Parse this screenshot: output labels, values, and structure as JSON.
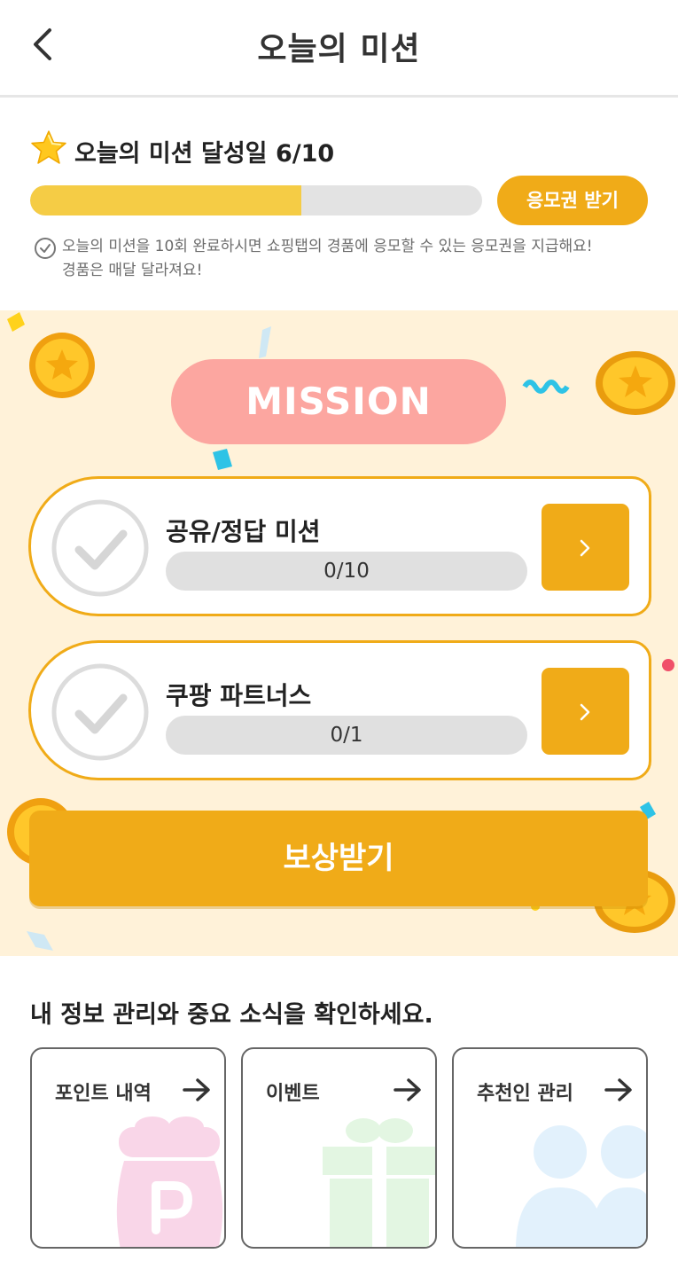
{
  "header": {
    "title": "오늘의 미션"
  },
  "progress": {
    "title": "오늘의 미션 달성일",
    "count": "6/10",
    "fraction": 0.6,
    "voucher_button": "응모권 받기",
    "notice_line1": "오늘의 미션을 10회 완료하시면 쇼핑탭의 경품에 응모할 수 있는 응모권을 지급해요!",
    "notice_line2": "경품은 매달 달라져요!"
  },
  "mission": {
    "badge": "MISSION",
    "cards": [
      {
        "title": "공유/정답 미션",
        "progress_text": "0/10"
      },
      {
        "title": "쿠팡 파트너스",
        "progress_text": "0/1"
      }
    ],
    "reward_button": "보상받기"
  },
  "info": {
    "title": "내 정보 관리와 중요 소식을 확인하세요.",
    "cards": [
      {
        "label": "포인트 내역",
        "icon": "point-pouch-icon"
      },
      {
        "label": "이벤트",
        "icon": "gift-icon"
      },
      {
        "label": "추천인 관리",
        "icon": "people-icon"
      }
    ]
  },
  "colors": {
    "accent": "#f0ab18",
    "progress_fill": "#f5cc45",
    "mission_badge": "#fca6a0",
    "mission_bg": "#fff2d9"
  }
}
